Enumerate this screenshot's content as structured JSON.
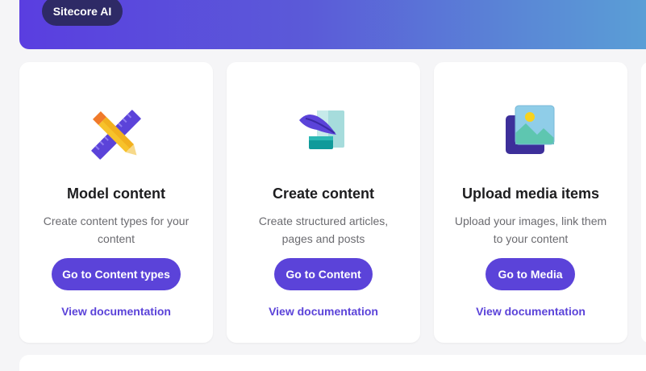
{
  "hero": {
    "ai_button_label": "Sitecore AI"
  },
  "cards": [
    {
      "title": "Model content",
      "description": "Create content types for your content",
      "button_label": "Go to Content types",
      "link_label": "View documentation",
      "icon": "ruler-pencil-icon"
    },
    {
      "title": "Create content",
      "description": "Create structured articles, pages and posts",
      "button_label": "Go to Content",
      "link_label": "View documentation",
      "icon": "quill-scroll-icon"
    },
    {
      "title": "Upload media items",
      "description": "Upload your images, link them to your content",
      "button_label": "Go to Media",
      "link_label": "View documentation",
      "icon": "image-gallery-icon"
    }
  ],
  "colors": {
    "accent": "#5b43d9",
    "pill_dark": "#2e2a66",
    "hero_start": "#5a3ee0",
    "hero_end": "#5aa0d6"
  }
}
